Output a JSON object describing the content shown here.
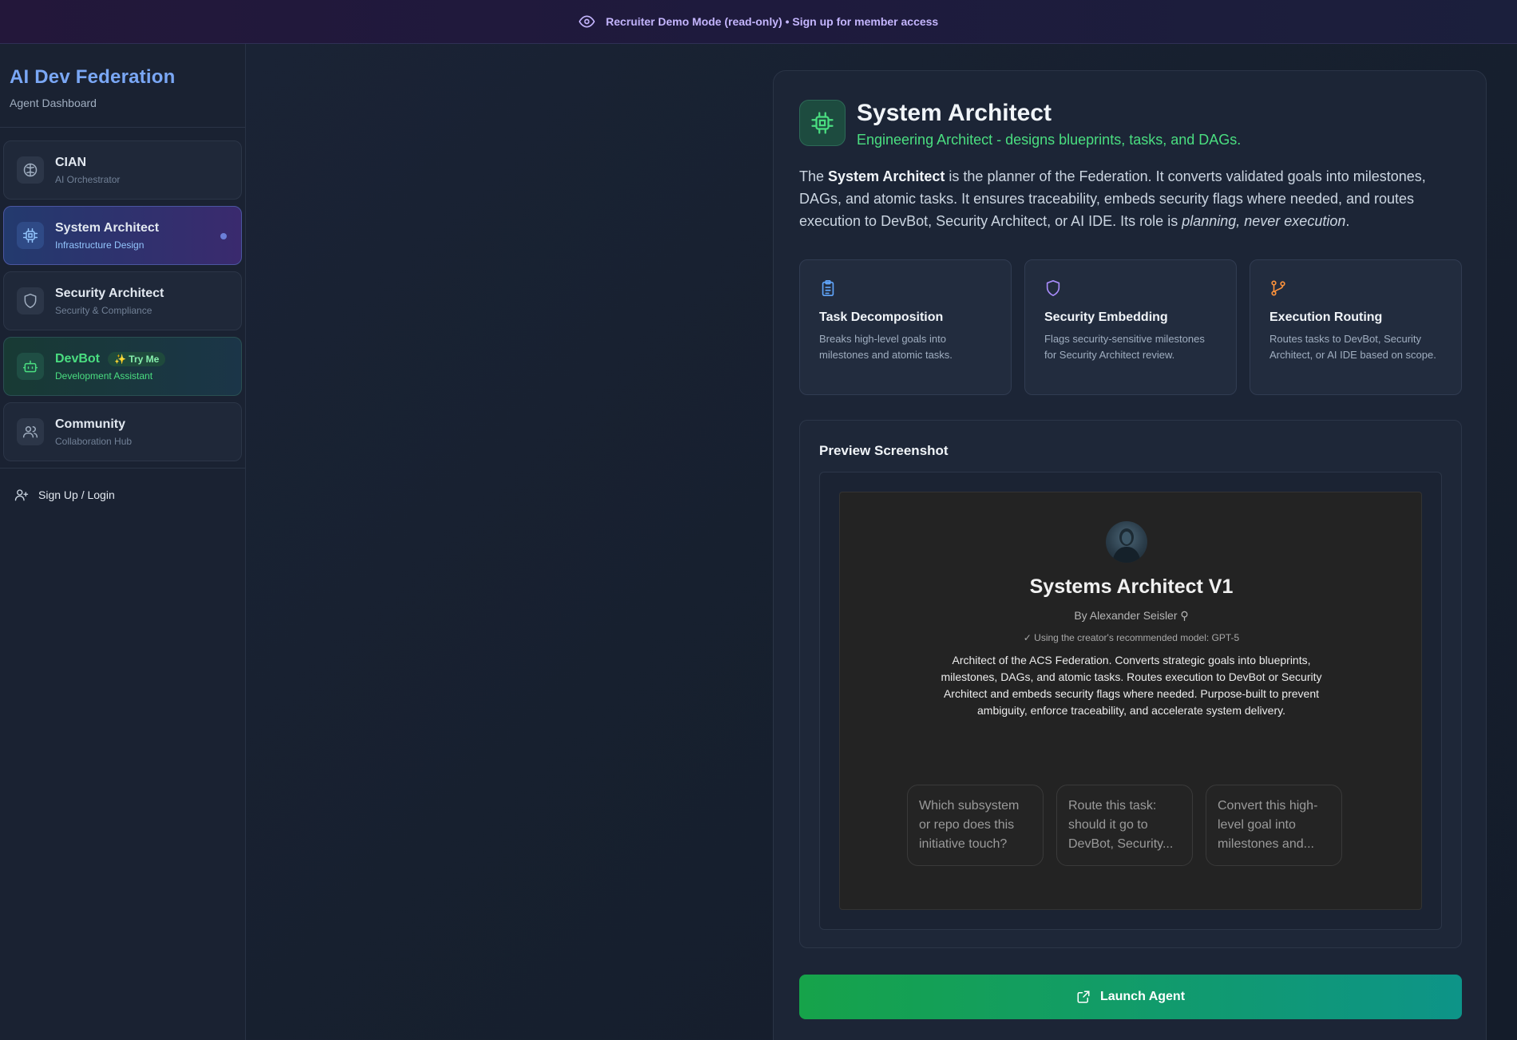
{
  "banner": {
    "text": "Recruiter Demo Mode (read-only) • Sign up for member access"
  },
  "sidebar": {
    "title": "AI Dev Federation",
    "subtitle": "Agent Dashboard",
    "items": [
      {
        "label": "CIAN",
        "sub": "AI Orchestrator",
        "icon": "brain-icon"
      },
      {
        "label": "System Architect",
        "sub": "Infrastructure Design",
        "icon": "cpu-icon",
        "active": true
      },
      {
        "label": "Security Architect",
        "sub": "Security & Compliance",
        "icon": "shield-icon"
      },
      {
        "label": "DevBot",
        "sub": "Development Assistant",
        "icon": "bot-icon",
        "badge": "Try Me"
      },
      {
        "label": "Community",
        "sub": "Collaboration Hub",
        "icon": "users-icon"
      }
    ],
    "signup_label": "Sign Up / Login"
  },
  "agent": {
    "title": "System Architect",
    "tagline": "Engineering Architect - designs blueprints, tasks, and DAGs.",
    "intro": {
      "p1": "The ",
      "strong": "System Architect",
      "p2": " is the planner of the Federation. It converts validated goals into milestones, DAGs, and atomic tasks. It ensures traceability, embeds security flags where needed, and routes execution to DevBot, Security Architect, or AI IDE. Its role is ",
      "em": "planning, never execution",
      "p3": "."
    },
    "features": [
      {
        "title": "Task Decomposition",
        "desc": "Breaks high-level goals into milestones and atomic tasks.",
        "icon": "clipboard-icon",
        "color": "#60a5fa"
      },
      {
        "title": "Security Embedding",
        "desc": "Flags security-sensitive milestones for Security Architect review.",
        "icon": "shield-icon",
        "color": "#a78bfa"
      },
      {
        "title": "Execution Routing",
        "desc": "Routes tasks to DevBot, Security Architect, or AI IDE based on scope.",
        "icon": "git-branch-icon",
        "color": "#fb923c"
      }
    ],
    "preview_title": "Preview Screenshot",
    "preview": {
      "name": "Systems Architect V1",
      "by": "By Alexander Seisler",
      "model": "Using the creator's recommended model: GPT-5",
      "desc": "Architect of the ACS Federation. Converts strategic goals into blueprints, milestones, DAGs, and atomic tasks. Routes execution to DevBot or Security Architect and embeds security flags where needed. Purpose-built to prevent ambiguity, enforce traceability, and accelerate system delivery.",
      "starters": [
        "Which subsystem or repo does this initiative touch?",
        "Route this task: should it go to DevBot, Security...",
        "Convert this high-level goal into milestones and..."
      ]
    },
    "launch_label": "Launch Agent"
  },
  "colors": {
    "accent_green": "#4ade80",
    "brand_blue": "#7aa7f5",
    "banner_purple": "#c4b5fd"
  }
}
